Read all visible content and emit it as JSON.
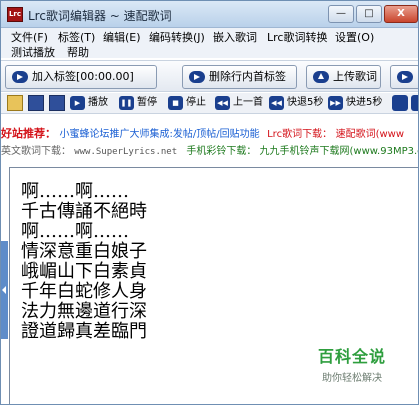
{
  "window": {
    "title": "Lrc歌词编辑器 ~ 速配歌词",
    "app_icon_text": "Lrc",
    "minimize": "—",
    "maximize": "□",
    "close": "X"
  },
  "menu": {
    "file": "文件(F)",
    "tag": "标签(T)",
    "edit": "编辑(E)",
    "encode": "编码转换(J)",
    "embed": "嵌入歌词",
    "lrc_convert": "Lrc歌词转换",
    "settings": "设置(O)",
    "test_play": "测试播放",
    "help": "帮助"
  },
  "toolbar_main": {
    "add_tag": "加入标签[00:00.00]",
    "delete_tag": "删除行内首标签",
    "upload": "上传歌词"
  },
  "toolbar_playback": {
    "play": "播放",
    "pause": "暂停",
    "stop": "停止",
    "prev": "上一首",
    "fast_back": "快退5秒",
    "fast_fwd": "快进5秒"
  },
  "ads": {
    "line1_label": "好站推荐：",
    "line1_link": "小蜜蜂论坛推广大师集成:发帖/顶帖/回贴功能",
    "line1_label2": "Lrc歌词下载：",
    "line1_link2": "速配歌词(www",
    "line2_label": "英文歌词下载：",
    "line2_site": "www.SuperLyrics.net",
    "line2_label2": "手机彩铃下载：",
    "line2_link2": "九九手机铃声下载网(www.93MP3.c"
  },
  "lyrics": "啊……啊……\n千古傳誦不絕時\n啊……啊……\n情深意重白娘子\n峨嵋山下白素貞\n千年白蛇修人身\n法力無邊道行深\n證道歸真差臨門",
  "watermark": {
    "logo": "百科全说",
    "subtitle": "助你轻松解决"
  },
  "colors": {
    "title_bg": "#c6d9ef",
    "menu_bg": "#eef2f8",
    "ad_red": "#d4131a",
    "ad_blue": "#1a5fd3",
    "ad_green": "#1e7a1e",
    "splitter": "#5e8cc9",
    "watermark_green": "#2e9e3e"
  }
}
